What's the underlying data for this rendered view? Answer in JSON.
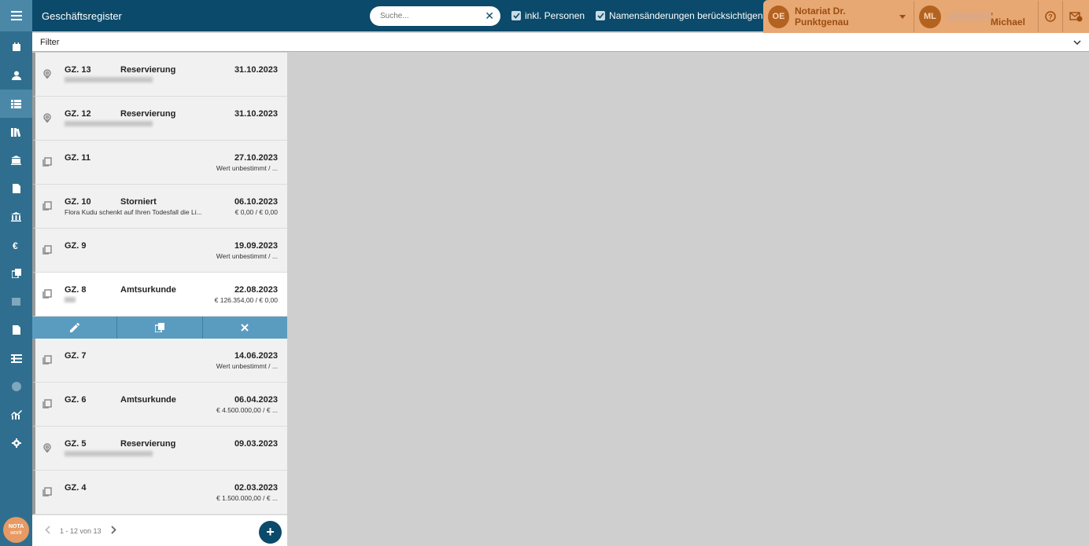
{
  "header": {
    "title": "Geschäftsregister",
    "search_placeholder": "Suche...",
    "incl_persons_label": "inkl. Personen",
    "name_changes_label": "Namensänderungen berücksichtigen"
  },
  "org": {
    "initials": "OE",
    "name": "Notariat Dr. Punktgenau"
  },
  "user": {
    "initials": "ML",
    "name_suffix": ", Michael"
  },
  "filter": {
    "label": "Filter"
  },
  "rail": {
    "items": [
      "calendar-icon",
      "person-icon",
      "list-icon",
      "library-icon",
      "bank-safe-icon",
      "document-icon",
      "institution-icon",
      "euro-icon",
      "copy-icon",
      "square-icon",
      "document-icon",
      "ledger-icon",
      "info-icon",
      "analytics-icon",
      "gear-icon"
    ],
    "logo_line1": "NOTA",
    "logo_line2": "work"
  },
  "rows": [
    {
      "gz": "GZ. 13",
      "kind": "Reservierung",
      "date": "31.10.2023",
      "desc": "",
      "value": "",
      "icon": "map-pin-icon",
      "blur": true
    },
    {
      "gz": "GZ. 12",
      "kind": "Reservierung",
      "date": "31.10.2023",
      "desc": "",
      "value": "",
      "icon": "map-pin-icon",
      "blur": true
    },
    {
      "gz": "GZ. 11",
      "kind": "",
      "date": "27.10.2023",
      "desc": "",
      "value": "Wert unbestimmt / ...",
      "icon": "document-stack-icon",
      "blur": false
    },
    {
      "gz": "GZ. 10",
      "kind": "Storniert",
      "date": "06.10.2023",
      "desc": "Flora Kudu schenkt auf Ihren Todesfall die Li...",
      "value": "€ 0,00 / € 0,00",
      "icon": "document-stack-icon",
      "blur": false
    },
    {
      "gz": "GZ. 9",
      "kind": "",
      "date": "19.09.2023",
      "desc": "",
      "value": "Wert unbestimmt / ...",
      "icon": "document-stack-icon",
      "blur": false
    },
    {
      "gz": "GZ. 8",
      "kind": "Amtsurkunde",
      "date": "22.08.2023",
      "desc": "",
      "value": "€ 126.354,00 / € 0,00",
      "icon": "document-stack-icon",
      "blur": true,
      "selected": true
    },
    {
      "gz": "GZ. 7",
      "kind": "",
      "date": "14.06.2023",
      "desc": "",
      "value": "Wert unbestimmt / ...",
      "icon": "document-stack-icon",
      "blur": false
    },
    {
      "gz": "GZ. 6",
      "kind": "Amtsurkunde",
      "date": "06.04.2023",
      "desc": "",
      "value": "€ 4.500.000,00 / € ...",
      "icon": "document-stack-icon",
      "blur": false
    },
    {
      "gz": "GZ. 5",
      "kind": "Reservierung",
      "date": "09.03.2023",
      "desc": "",
      "value": "",
      "icon": "map-pin-icon",
      "blur": true
    },
    {
      "gz": "GZ. 4",
      "kind": "",
      "date": "02.03.2023",
      "desc": "",
      "value": "€ 1.500.000,00 / € ...",
      "icon": "document-stack-icon",
      "blur": false
    }
  ],
  "pagination": {
    "label": "1 - 12 von 13"
  }
}
